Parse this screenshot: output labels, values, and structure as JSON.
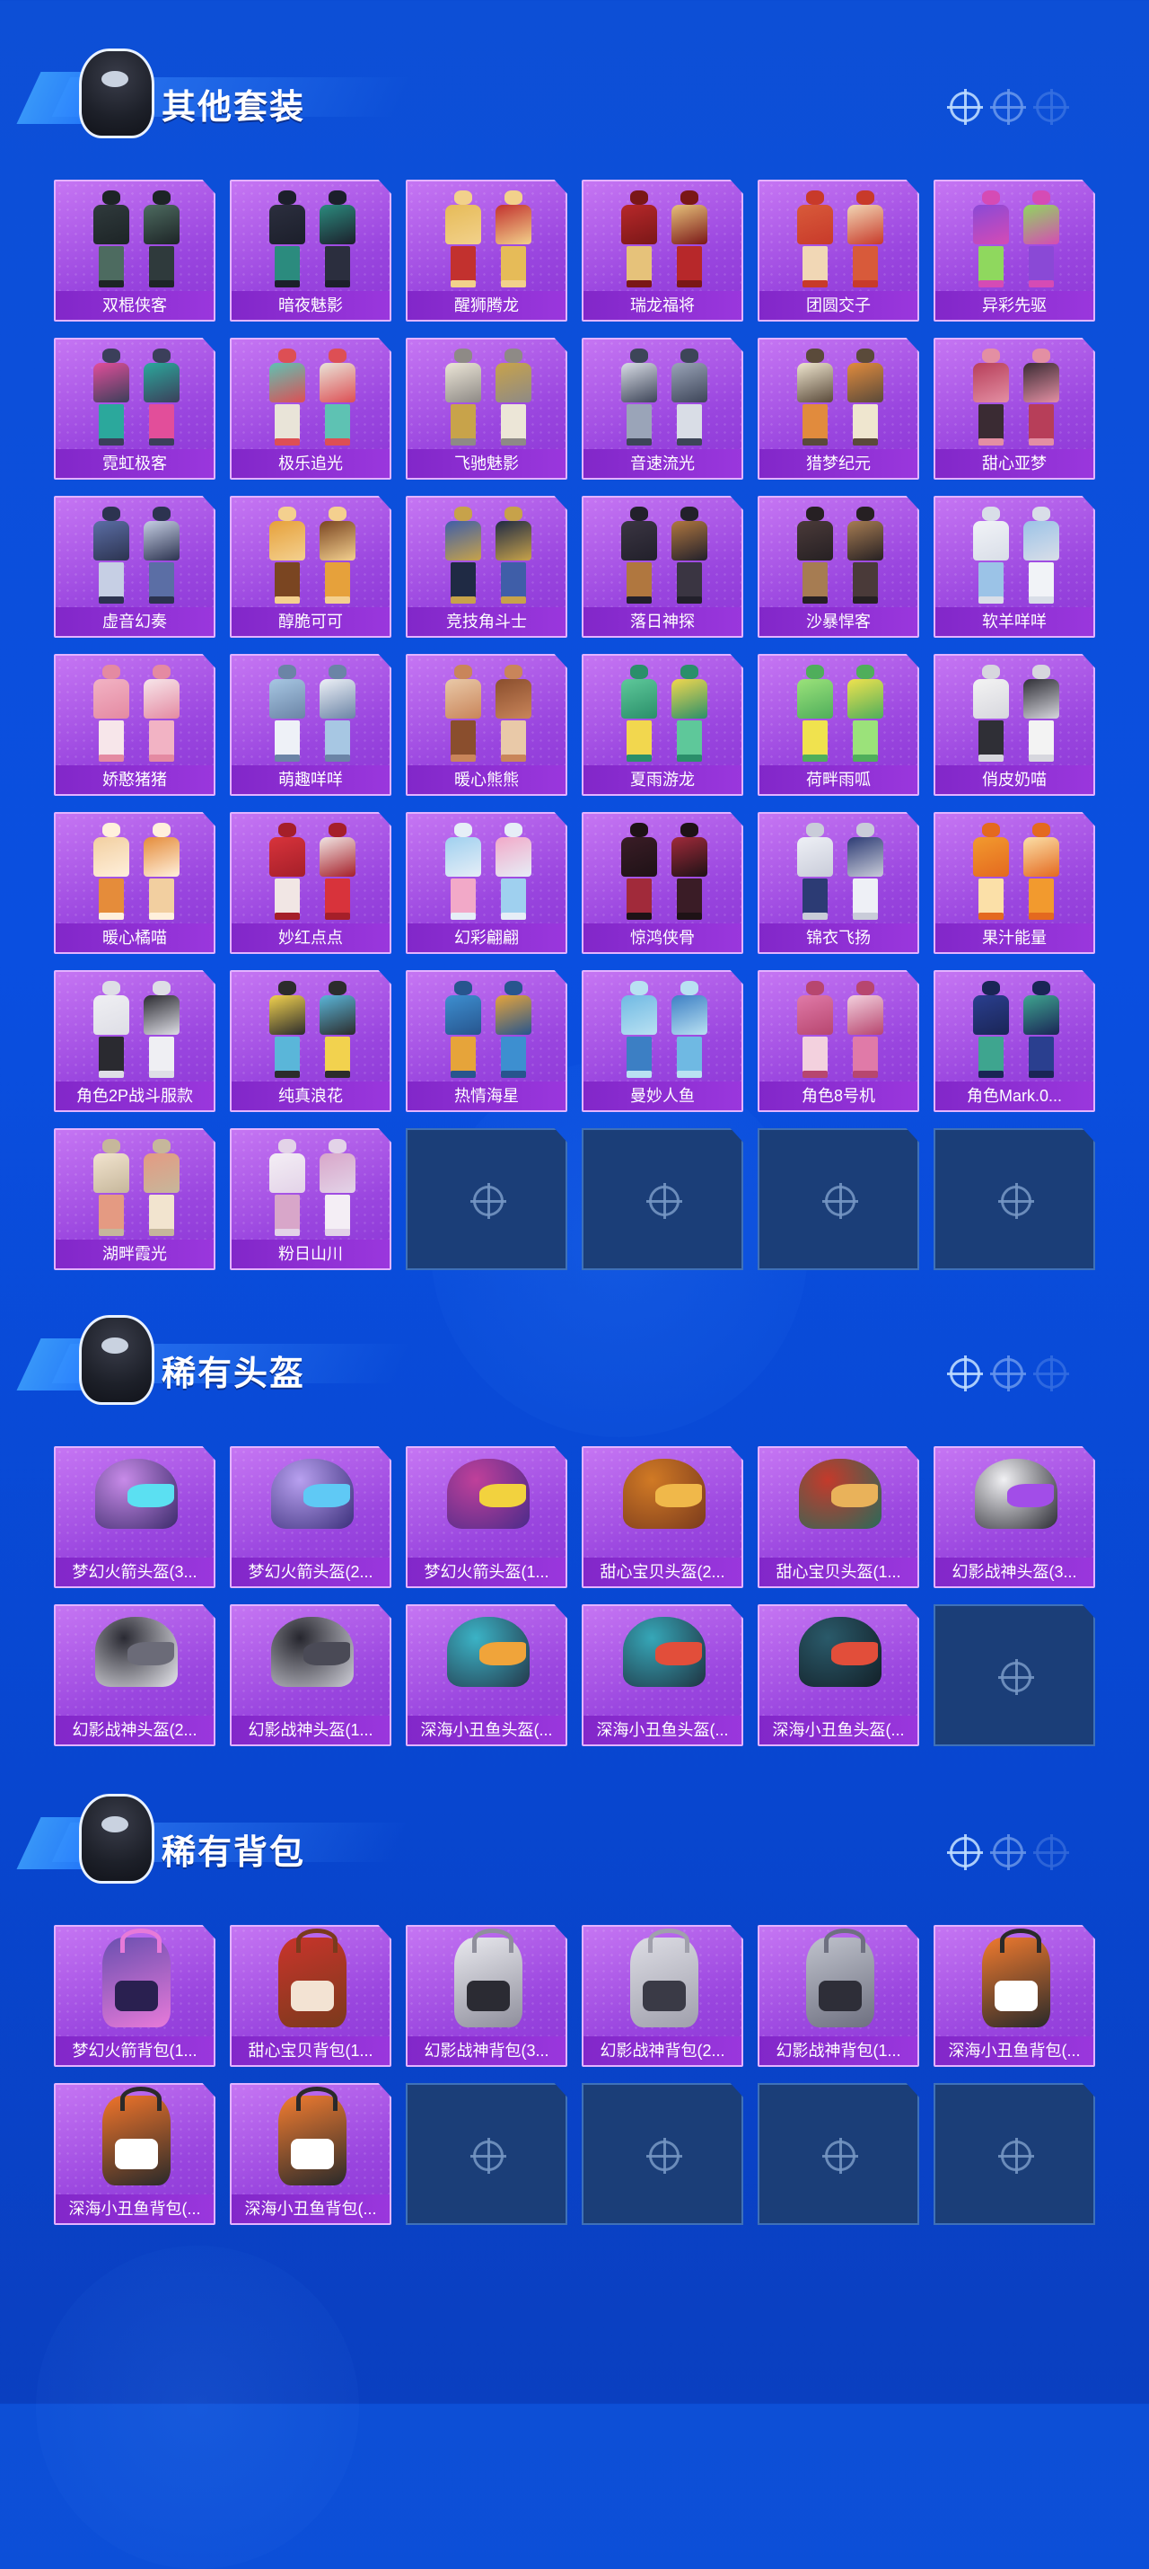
{
  "sections": {
    "outfits": {
      "title": "其他套装",
      "items": [
        {
          "name": "双棍侠客",
          "colors": [
            "#2f3a3c",
            "#4d6b60",
            "#1d2426"
          ]
        },
        {
          "name": "暗夜魅影",
          "colors": [
            "#2b2e3e",
            "#2b8b7e",
            "#1c1f2b"
          ]
        },
        {
          "name": "醒狮腾龙",
          "colors": [
            "#e6bb58",
            "#c2312e",
            "#f2d18b"
          ]
        },
        {
          "name": "瑞龙福将",
          "colors": [
            "#b7282a",
            "#e6c27a",
            "#7a1717"
          ]
        },
        {
          "name": "团圆交子",
          "colors": [
            "#d85a3a",
            "#f1d7b5",
            "#c83a2a"
          ]
        },
        {
          "name": "异彩先驱",
          "colors": [
            "#8a49d6",
            "#8fd85e",
            "#d54bb5"
          ]
        },
        {
          "name": "霓虹极客",
          "colors": [
            "#e24e9a",
            "#2ba89c",
            "#3b3f5a"
          ]
        },
        {
          "name": "极乐追光",
          "colors": [
            "#5ec2b3",
            "#e9e4d8",
            "#dd4f54"
          ]
        },
        {
          "name": "飞驰魅影",
          "colors": [
            "#ece6d7",
            "#c8a34a",
            "#8e8a86"
          ]
        },
        {
          "name": "音速流光",
          "colors": [
            "#d9dde6",
            "#9aa4b8",
            "#3d4558"
          ]
        },
        {
          "name": "猎梦纪元",
          "colors": [
            "#efe6cf",
            "#e18b3d",
            "#5a4a3a"
          ]
        },
        {
          "name": "甜心亚梦",
          "colors": [
            "#b73e59",
            "#3a2b33",
            "#e38fa3"
          ]
        },
        {
          "name": "虚音幻奏",
          "colors": [
            "#5b6ea5",
            "#c6cfe4",
            "#2c3350"
          ]
        },
        {
          "name": "醇脆可可",
          "colors": [
            "#e6a13b",
            "#7a4521",
            "#f4d08f"
          ]
        },
        {
          "name": "竞技角斗士",
          "colors": [
            "#3f5ea8",
            "#1f2a44",
            "#c7a24a"
          ]
        },
        {
          "name": "落日神探",
          "colors": [
            "#3a3542",
            "#b0773f",
            "#22202b"
          ]
        },
        {
          "name": "沙暴悍客",
          "colors": [
            "#4a3a39",
            "#a67c52",
            "#262023"
          ]
        },
        {
          "name": "软羊咩咩",
          "colors": [
            "#f1f3f7",
            "#9bc3e7",
            "#d9dee8"
          ]
        },
        {
          "name": "娇憨猪猪",
          "colors": [
            "#f2b3c4",
            "#f7e6ea",
            "#e48aa2"
          ]
        },
        {
          "name": "萌趣咩咩",
          "colors": [
            "#a7c7e3",
            "#eef1f7",
            "#6b84a6"
          ]
        },
        {
          "name": "暖心熊熊",
          "colors": [
            "#e9c9a8",
            "#8a4e2d",
            "#c9855a"
          ]
        },
        {
          "name": "夏雨游龙",
          "colors": [
            "#5ec89a",
            "#f2d74e",
            "#2a8f6a"
          ]
        },
        {
          "name": "荷畔雨呱",
          "colors": [
            "#9be27a",
            "#f0e24e",
            "#4fae5b"
          ]
        },
        {
          "name": "俏皮奶喵",
          "colors": [
            "#f3f3f3",
            "#2f2f36",
            "#d7d7de"
          ]
        },
        {
          "name": "暖心橘喵",
          "colors": [
            "#f2cfa0",
            "#e58c3a",
            "#fff0dc"
          ]
        },
        {
          "name": "妙红点点",
          "colors": [
            "#d8333b",
            "#f1e6e4",
            "#a51f29"
          ]
        },
        {
          "name": "幻彩翩翩",
          "colors": [
            "#9fd0ef",
            "#f2a9c8",
            "#e6eef7"
          ]
        },
        {
          "name": "惊鸿侠骨",
          "colors": [
            "#3a1c26",
            "#a12a3a",
            "#1e1216"
          ]
        },
        {
          "name": "锦衣飞扬",
          "colors": [
            "#eef0f6",
            "#2c3b74",
            "#c9ccd9"
          ]
        },
        {
          "name": "果汁能量",
          "colors": [
            "#f29a2e",
            "#fbe0a8",
            "#e4691f"
          ]
        },
        {
          "name": "角色2P战斗服款",
          "colors": [
            "#efeff3",
            "#2a2a30",
            "#dedee6"
          ]
        },
        {
          "name": "纯真浪花",
          "colors": [
            "#f2d24e",
            "#5ab6d9",
            "#2c2c2c"
          ]
        },
        {
          "name": "热情海星",
          "colors": [
            "#3d8fd0",
            "#e6a43a",
            "#27558e"
          ]
        },
        {
          "name": "曼妙人鱼",
          "colors": [
            "#6fb9e3",
            "#3c7fc4",
            "#b9e1f2"
          ]
        },
        {
          "name": "角色8号机",
          "colors": [
            "#e07aa8",
            "#f3d1de",
            "#b7466f"
          ]
        },
        {
          "name": "角色Mark.0...",
          "colors": [
            "#2a3f8f",
            "#3ea58f",
            "#1a2556"
          ]
        },
        {
          "name": "湖畔霞光",
          "colors": [
            "#f2e4cf",
            "#e49a82",
            "#c6b79b"
          ]
        },
        {
          "name": "粉日山川",
          "colors": [
            "#f4eef5",
            "#d8a6c9",
            "#e3d3e8"
          ]
        }
      ],
      "empty_slots": 4
    },
    "helmets": {
      "title": "稀有头盔",
      "items": [
        {
          "name": "梦幻火箭头盔(3...",
          "colors": [
            "#c88be9",
            "#3a2a6a",
            "#5be0f2"
          ]
        },
        {
          "name": "梦幻火箭头盔(2...",
          "colors": [
            "#b8a0f0",
            "#3a2f7a",
            "#5fc9f5"
          ]
        },
        {
          "name": "梦幻火箭头盔(1...",
          "colors": [
            "#c0409a",
            "#4a2b8a",
            "#f2d23e"
          ]
        },
        {
          "name": "甜心宝贝头盔(2...",
          "colors": [
            "#d17a25",
            "#7a3a1c",
            "#f0b84a"
          ]
        },
        {
          "name": "甜心宝贝头盔(1...",
          "colors": [
            "#c43a2b",
            "#2a6a5a",
            "#e9b25a"
          ]
        },
        {
          "name": "幻影战神头盔(3...",
          "colors": [
            "#f1f1f4",
            "#2b2b33",
            "#a24de8"
          ]
        },
        {
          "name": "幻影战神头盔(2...",
          "colors": [
            "#2a2a33",
            "#e8e8ee",
            "#6b6b78"
          ]
        },
        {
          "name": "幻影战神头盔(1...",
          "colors": [
            "#26262e",
            "#cfcfd8",
            "#4a4a56"
          ]
        },
        {
          "name": "深海小丑鱼头盔(...",
          "colors": [
            "#3bb3c6",
            "#24384a",
            "#f0a43a"
          ]
        },
        {
          "name": "深海小丑鱼头盔(...",
          "colors": [
            "#36a7b8",
            "#1f3240",
            "#e24e3a"
          ]
        },
        {
          "name": "深海小丑鱼头盔(...",
          "colors": [
            "#2a5a6a",
            "#132028",
            "#e24e3a"
          ]
        }
      ],
      "empty_slots": 1
    },
    "backpacks": {
      "title": "稀有背包",
      "items": [
        {
          "name": "梦幻火箭背包(1...",
          "colors": [
            "#6a4fb0",
            "#2a2050",
            "#e77ad9"
          ]
        },
        {
          "name": "甜心宝贝背包(1...",
          "colors": [
            "#c9342b",
            "#f3e3d3",
            "#7a3a1c"
          ]
        },
        {
          "name": "幻影战神背包(3...",
          "colors": [
            "#e8e8ee",
            "#2b2b33",
            "#8f8f9c"
          ]
        },
        {
          "name": "幻影战神背包(2...",
          "colors": [
            "#dcdce4",
            "#3a3a46",
            "#a0a0ac"
          ]
        },
        {
          "name": "幻影战神背包(1...",
          "colors": [
            "#bfc2cc",
            "#2e2e38",
            "#6e7080"
          ]
        },
        {
          "name": "深海小丑鱼背包(...",
          "colors": [
            "#f07a2e",
            "#ffffff",
            "#2a2a2a"
          ]
        },
        {
          "name": "深海小丑鱼背包(...",
          "colors": [
            "#f0742a",
            "#ffffff",
            "#2a2a2a"
          ]
        },
        {
          "name": "深海小丑鱼背包(...",
          "colors": [
            "#f27c30",
            "#ffffff",
            "#2a2a2a"
          ]
        }
      ],
      "empty_slots": 4
    }
  }
}
